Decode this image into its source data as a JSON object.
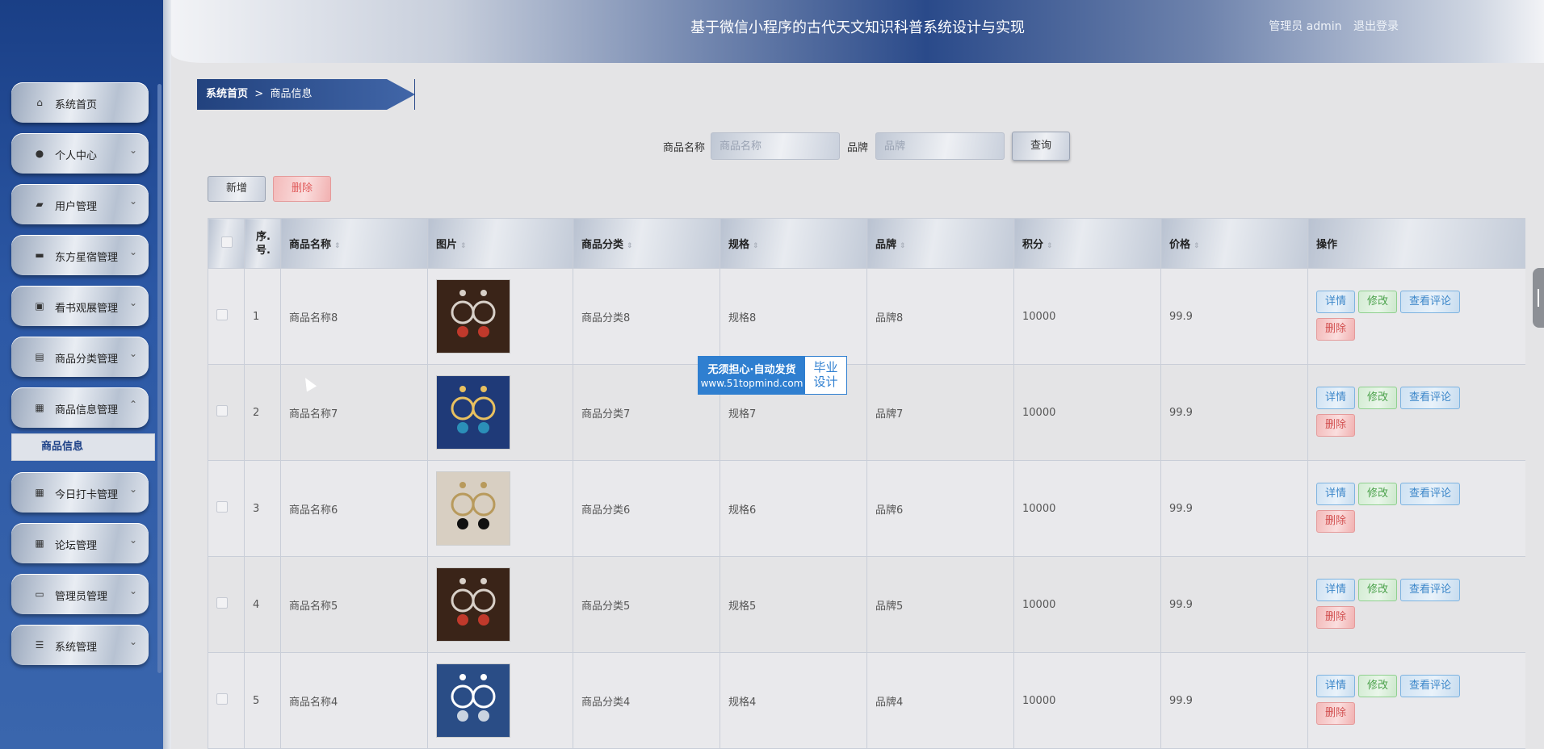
{
  "header": {
    "title": "基于微信小程序的古代天文知识科普系统设计与实现",
    "user_label": "管理员 admin",
    "logout": "退出登录"
  },
  "sidebar": {
    "items": [
      {
        "label": "系统首页",
        "icon": "home-icon",
        "glyph": "⌂",
        "chevron": ""
      },
      {
        "label": "个人中心",
        "icon": "user-icon",
        "glyph": "●",
        "chevron": "⌄"
      },
      {
        "label": "用户管理",
        "icon": "briefcase-icon",
        "glyph": "▰",
        "chevron": "⌄"
      },
      {
        "label": "东方星宿管理",
        "icon": "chat-icon",
        "glyph": "▬",
        "chevron": "⌄"
      },
      {
        "label": "看书观展管理",
        "icon": "bag-icon",
        "glyph": "▣",
        "chevron": "⌄"
      },
      {
        "label": "商品分类管理",
        "icon": "clipboard-icon",
        "glyph": "▤",
        "chevron": "⌄"
      },
      {
        "label": "商品信息管理",
        "icon": "grid-icon",
        "glyph": "▦",
        "chevron": "⌃"
      },
      {
        "label": "今日打卡管理",
        "icon": "grid-icon",
        "glyph": "▦",
        "chevron": "⌄"
      },
      {
        "label": "论坛管理",
        "icon": "grid-icon",
        "glyph": "▦",
        "chevron": "⌄"
      },
      {
        "label": "管理员管理",
        "icon": "monitor-icon",
        "glyph": "▭",
        "chevron": "⌄"
      },
      {
        "label": "系统管理",
        "icon": "list-icon",
        "glyph": "☰",
        "chevron": "⌄"
      }
    ],
    "submenu": "商品信息"
  },
  "breadcrumb": {
    "home": "系统首页",
    "separator": ">",
    "current": "商品信息"
  },
  "search": {
    "name_label": "商品名称",
    "name_placeholder": "商品名称",
    "brand_label": "品牌",
    "brand_placeholder": "品牌",
    "query_button": "查询"
  },
  "actions": {
    "add": "新增",
    "delete": "删除"
  },
  "table": {
    "headers": [
      "序号",
      "商品名称",
      "图片",
      "商品分类",
      "规格",
      "品牌",
      "积分",
      "价格",
      "操作"
    ],
    "seq_header_line1": "序.",
    "seq_header_line2": "号.",
    "rows": [
      {
        "no": "1",
        "name": "商品名称8",
        "category": "商品分类8",
        "spec": "规格8",
        "brand": "品牌8",
        "points": "10000",
        "price": "99.9",
        "image": "red-drop-earrings"
      },
      {
        "no": "2",
        "name": "商品名称7",
        "category": "商品分类7",
        "spec": "规格7",
        "brand": "品牌7",
        "points": "10000",
        "price": "99.9",
        "image": "blue-crystal-earrings"
      },
      {
        "no": "3",
        "name": "商品名称6",
        "category": "商品分类6",
        "spec": "规格6",
        "brand": "品牌6",
        "points": "10000",
        "price": "99.9",
        "image": "black-gold-earrings"
      },
      {
        "no": "4",
        "name": "商品名称5",
        "category": "商品分类5",
        "spec": "规格5",
        "brand": "品牌5",
        "points": "10000",
        "price": "99.9",
        "image": "red-drop-earrings"
      },
      {
        "no": "5",
        "name": "商品名称4",
        "category": "商品分类4",
        "spec": "规格4",
        "brand": "品牌4",
        "points": "10000",
        "price": "99.9",
        "image": "silver-bracelet"
      }
    ],
    "ops": {
      "detail": "详情",
      "edit": "修改",
      "comments": "查看评论",
      "delete": "删除"
    }
  },
  "watermark": {
    "line1": "无须担心·自动发货",
    "line2": "www.51topmind.com",
    "right1": "毕业",
    "right2": "设计"
  },
  "colors": {
    "sidebar": "#2c58a5",
    "breadcrumb": "#22427e",
    "watermark": "#2f7fd0",
    "danger": "#d24f4f",
    "success": "#4aa14a",
    "info": "#3b86c9"
  }
}
